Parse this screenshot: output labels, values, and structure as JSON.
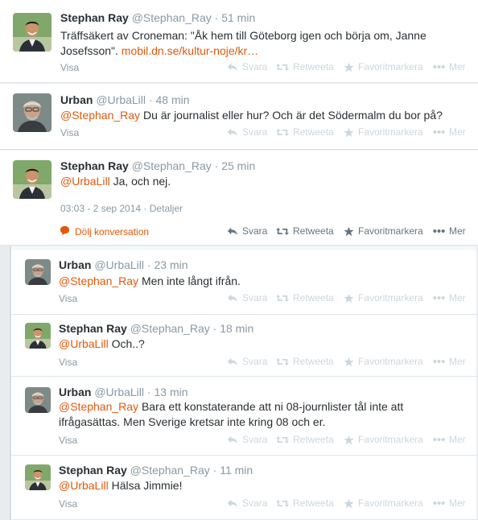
{
  "labels": {
    "visa": "Visa",
    "reply": "Svara",
    "retweet": "Retweeta",
    "favorite": "Favoritmarkera",
    "more": "Mer",
    "hide_conversation": "Dölj konversation",
    "details": "Detaljer",
    "dot": "·"
  },
  "tweets": [
    {
      "name": "Stephan Ray",
      "handle": "@Stephan_Ray",
      "time": "51 min",
      "text_prefix": "Träffsäkert av Croneman: \"Åk hem till Göteborg igen och börja om, Janne Josefsson\". ",
      "link": "mobil.dn.se/kultur-noje/kr…"
    },
    {
      "name": "Urban",
      "handle": "@UrbaLill",
      "time": "48 min",
      "mention": "@Stephan_Ray",
      "text": " Du är journalist eller hur? Och är det Södermalm du bor på?"
    },
    {
      "name": "Stephan Ray",
      "handle": "@Stephan_Ray",
      "time": "25 min",
      "mention": "@UrbaLill",
      "text": " Ja, och nej.",
      "timestamp": "03:03 - 2 sep 2014"
    },
    {
      "name": "Urban",
      "handle": "@UrbaLill",
      "time": "23 min",
      "mention": "@Stephan_Ray",
      "text": " Men inte långt ifrån."
    },
    {
      "name": "Stephan Ray",
      "handle": "@Stephan_Ray",
      "time": "18 min",
      "mention": "@UrbaLill",
      "text": " Och..?"
    },
    {
      "name": "Urban",
      "handle": "@UrbaLill",
      "time": "13 min",
      "mention": "@Stephan_Ray",
      "text": " Bara ett konstaterande att ni 08-journlister tål inte att ifrågasättas. Men Sverige kretsar inte kring 08 och er."
    },
    {
      "name": "Stephan Ray",
      "handle": "@Stephan_Ray",
      "time": "11 min",
      "mention": "@UrbaLill",
      "text": " Hälsa Jimmie!"
    }
  ],
  "colors": {
    "accent": "#e0590b",
    "muted": "#8899a6",
    "text": "#292f33"
  },
  "icons": {
    "reply": "reply-icon",
    "retweet": "retweet-icon",
    "favorite": "star-icon",
    "more": "more-dots-icon",
    "conversation": "speech-bubble-icon"
  }
}
